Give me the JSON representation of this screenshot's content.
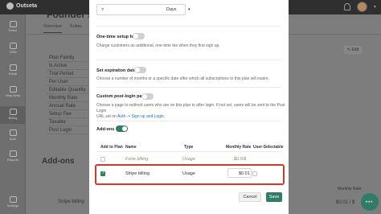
{
  "topbar": {
    "brand": "Outseta"
  },
  "sidebar": {
    "items": [
      {
        "label": "Home"
      },
      {
        "label": "CRM"
      },
      {
        "label": "Email"
      },
      {
        "label": "Help Desk"
      },
      {
        "label": "Billing"
      },
      {
        "label": "Auth"
      },
      {
        "label": "Reports"
      },
      {
        "label": "Settings"
      }
    ]
  },
  "background": {
    "title": "Founder's P",
    "tabs": [
      "Overview",
      "Subsc"
    ],
    "edit_label": "✎ Edit",
    "rows": [
      "Plan Family",
      "Is Active",
      "Trial Period",
      "Per User",
      "Editable Quantity",
      "Monthly Rate",
      "Annual Rate",
      "Setup Fee",
      "Taxable",
      "Post Login"
    ],
    "addons_heading": "Add-ons",
    "list_header": "Monthly Rate",
    "stripe_label": "Stripe billing",
    "stripe_price": "$0.01 / $"
  },
  "modal": {
    "days_value": "?",
    "days_select": "Days",
    "one_time": {
      "title": "One-time setup fee",
      "desc": "Charge customers an additional, one-time fee when they first sign up."
    },
    "expiration": {
      "title": "Set expiration date",
      "desc": "Choose a number of months or a specific date after which all subscriptions to this plan will expire."
    },
    "post_login": {
      "title": "Custom post-login path",
      "desc": "Choose a page to redirect users who are on this plan to after login. If not set, users will be sent to the Post Login",
      "desc2_prefix": "URL set on ",
      "desc2_link": "Auth -> Sign up and Login",
      "desc2_suffix": "."
    },
    "addons": {
      "title": "Add-ons",
      "headers": {
        "add": "Add to Plan",
        "name": "Name",
        "type": "Type",
        "rate": "Monthly Rate",
        "selectable": "User-Selectable"
      },
      "rows": [
        {
          "name": "Forte billing",
          "type": "Usage",
          "rate": "$0.0/$",
          "checked": false
        },
        {
          "name": "Stripe billing",
          "type": "Usage",
          "rate": "$0.01",
          "checked": true
        }
      ]
    },
    "cancel_label": "Cancel",
    "save_label": "Save"
  }
}
